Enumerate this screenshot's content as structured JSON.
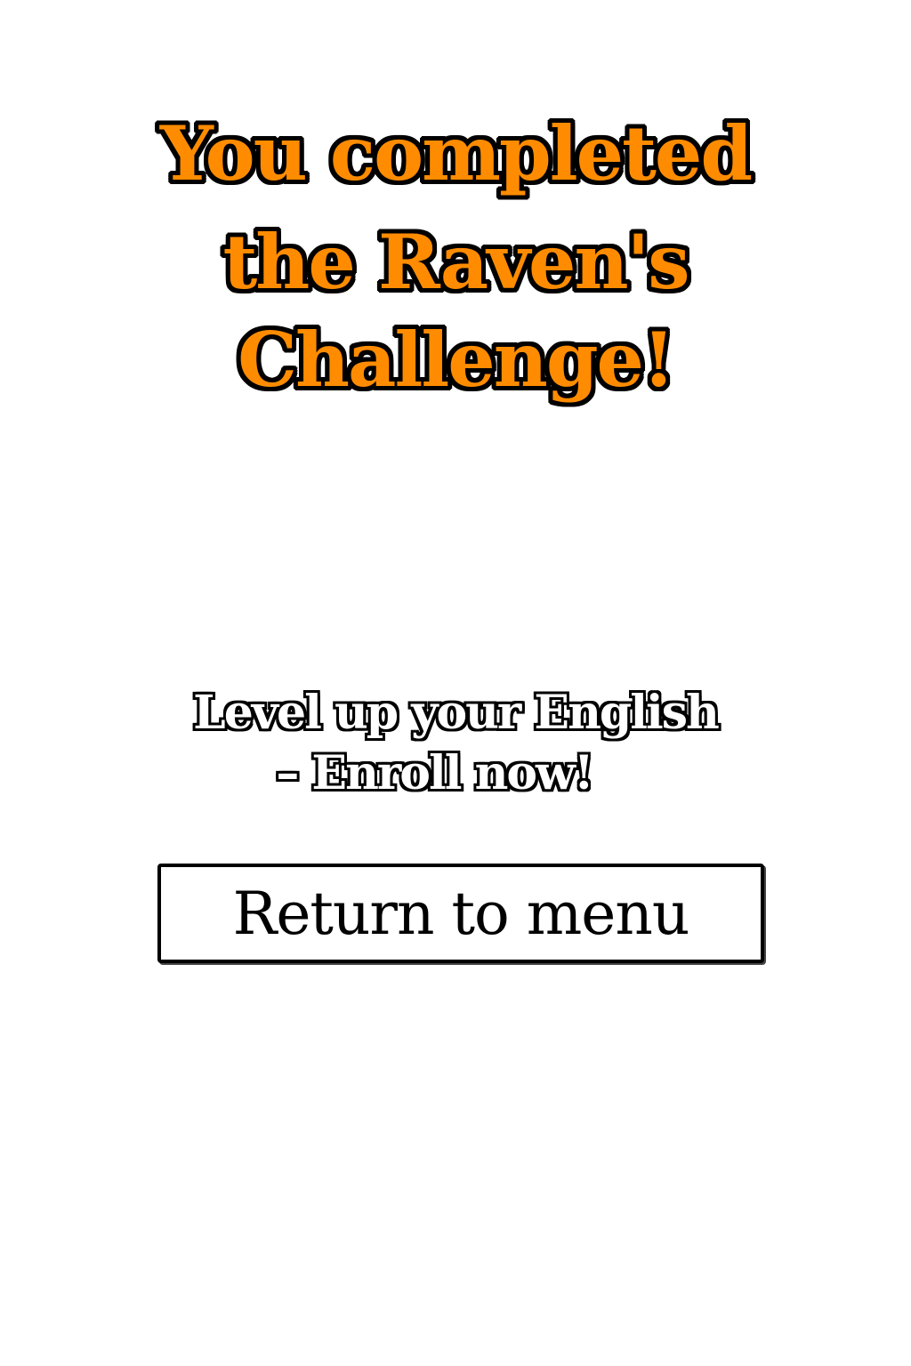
{
  "title": {
    "line1": "You completed",
    "line2": "the Raven's Challenge!"
  },
  "promo": {
    "line1": "Level up your English",
    "line2": "– Enroll now!"
  },
  "menu_button": {
    "label": "Return to menu"
  },
  "colors": {
    "title_fill": "#ff8c00",
    "outline": "#000000",
    "background": "#ffffff"
  }
}
